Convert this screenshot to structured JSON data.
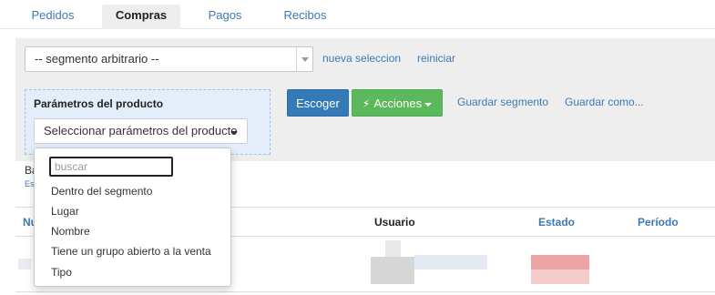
{
  "tabs": [
    {
      "label": "Pedidos",
      "active": false
    },
    {
      "label": "Compras",
      "active": true
    },
    {
      "label": "Pagos",
      "active": false
    },
    {
      "label": "Recibos",
      "active": false
    }
  ],
  "toolbar": {
    "segment_select_value": "-- segmento arbitrario --",
    "new_selection_label": "nueva seleccion",
    "reset_label": "reiniciar"
  },
  "params": {
    "title": "Parámetros del producto",
    "select_label": "Seleccionar parámetros del producto"
  },
  "actions": {
    "choose_label": "Escoger",
    "actions_label": "Acciones",
    "save_segment_label": "Guardar segmento",
    "save_as_label": "Guardar como..."
  },
  "partial_text": {
    "left_label_fragment": "Ba",
    "left_small_fragment": "Es",
    "column_fragment": "Nu"
  },
  "table": {
    "columns": [
      "Usuario",
      "Estado",
      "Período"
    ]
  },
  "dropdown": {
    "search_placeholder": "buscar",
    "items": [
      "Dentro del segmento",
      "Lugar",
      "Nombre",
      "Tiene un grupo abierto a la venta",
      "Tipo"
    ]
  },
  "colors": {
    "link": "#3c7ab5",
    "primary_button": "#337ab7",
    "success_button": "#5cb85c",
    "params_background": "#e3eefa",
    "panel_background": "#eeeeee"
  },
  "icons": [
    "caret-down-icon",
    "bolt-icon"
  ]
}
